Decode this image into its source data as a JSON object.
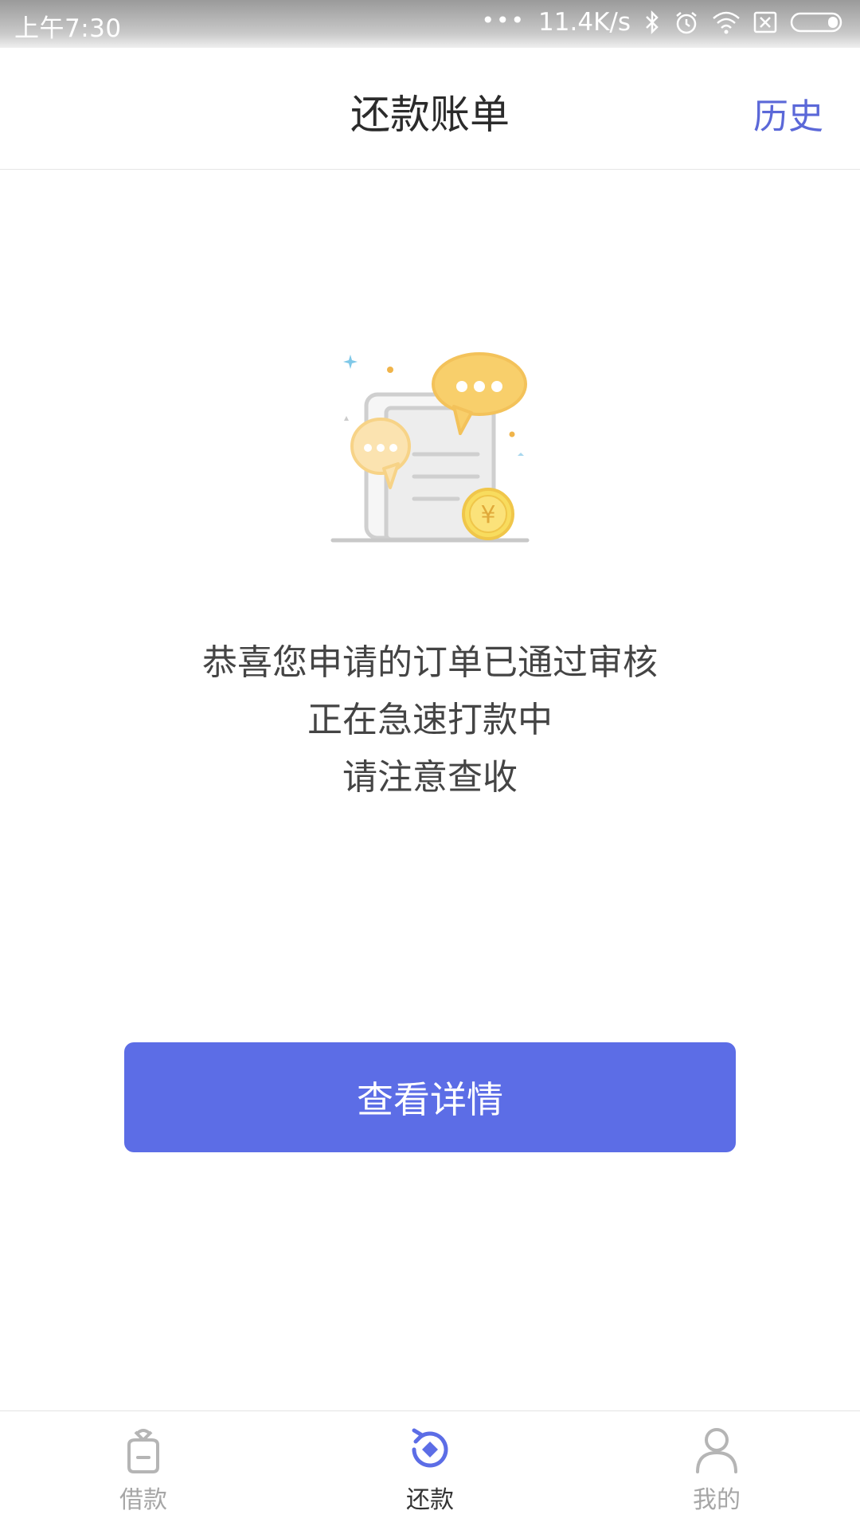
{
  "status_bar": {
    "time": "上午7:30",
    "network_speed": "11.4K/s",
    "icons": [
      "more-dots-icon",
      "bluetooth-icon",
      "alarm-icon",
      "wifi-icon",
      "sim-off-icon",
      "battery-icon"
    ]
  },
  "header": {
    "title": "还款账单",
    "history_label": "历史"
  },
  "illustration": {
    "currency_symbol": "¥",
    "icons": [
      "document-icon",
      "chat-bubble-icon",
      "coin-icon"
    ]
  },
  "message": {
    "line1": "恭喜您申请的订单已通过审核",
    "line2": "正在急速打款中",
    "line3": "请注意查收"
  },
  "primary_button": {
    "label": "查看详情"
  },
  "tab_bar": {
    "active_index": 1,
    "tabs": [
      {
        "label": "借款",
        "icon": "loan-bag-icon"
      },
      {
        "label": "还款",
        "icon": "repay-cycle-icon"
      },
      {
        "label": "我的",
        "icon": "user-icon"
      }
    ]
  },
  "colors": {
    "accent": "#5c6de6",
    "accent_text": "#5b68d8",
    "title_text": "#2b2b2b",
    "body_text": "#444444",
    "inactive_tab": "#a6a6a6",
    "coin": "#f5d76e",
    "bubble": "#f3c25a"
  }
}
